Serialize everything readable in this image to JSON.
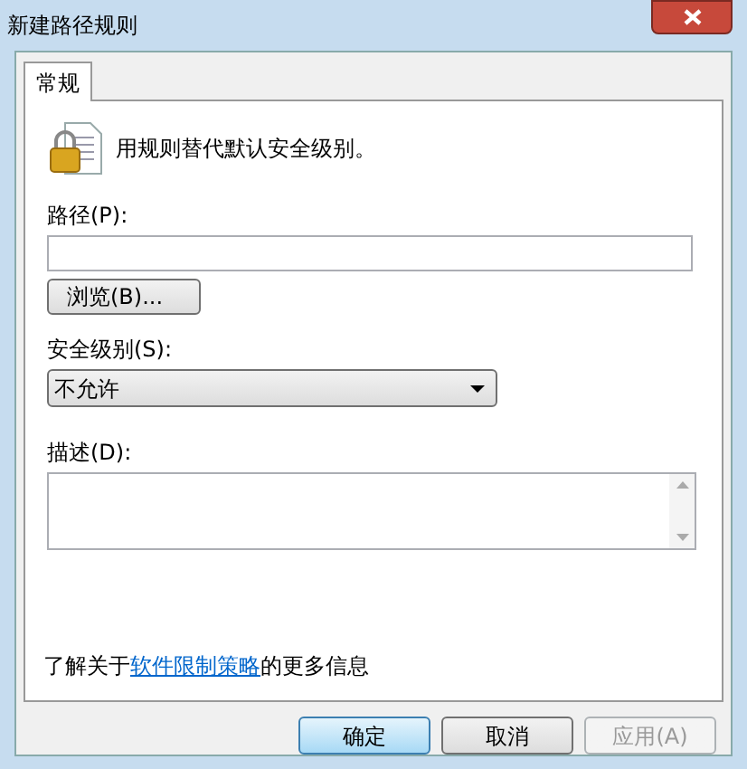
{
  "window": {
    "title": "新建路径规则"
  },
  "tabs": [
    {
      "label": "常规",
      "selected": true
    }
  ],
  "intro": "用规则替代默认安全级别。",
  "path": {
    "label": "路径(P):"
  },
  "browse_button": "浏览(B)...",
  "security_level": {
    "label": "安全级别(S):",
    "value": "不允许"
  },
  "description": {
    "label": "描述(D):"
  },
  "info": {
    "before": "了解关于",
    "link": "软件限制策略",
    "after": "的更多信息"
  },
  "buttons": [
    {
      "label": "确定",
      "default": true,
      "disabled": false
    },
    {
      "label": "取消",
      "default": false,
      "disabled": false
    },
    {
      "label": "应用(A)",
      "default": false,
      "disabled": true
    }
  ]
}
